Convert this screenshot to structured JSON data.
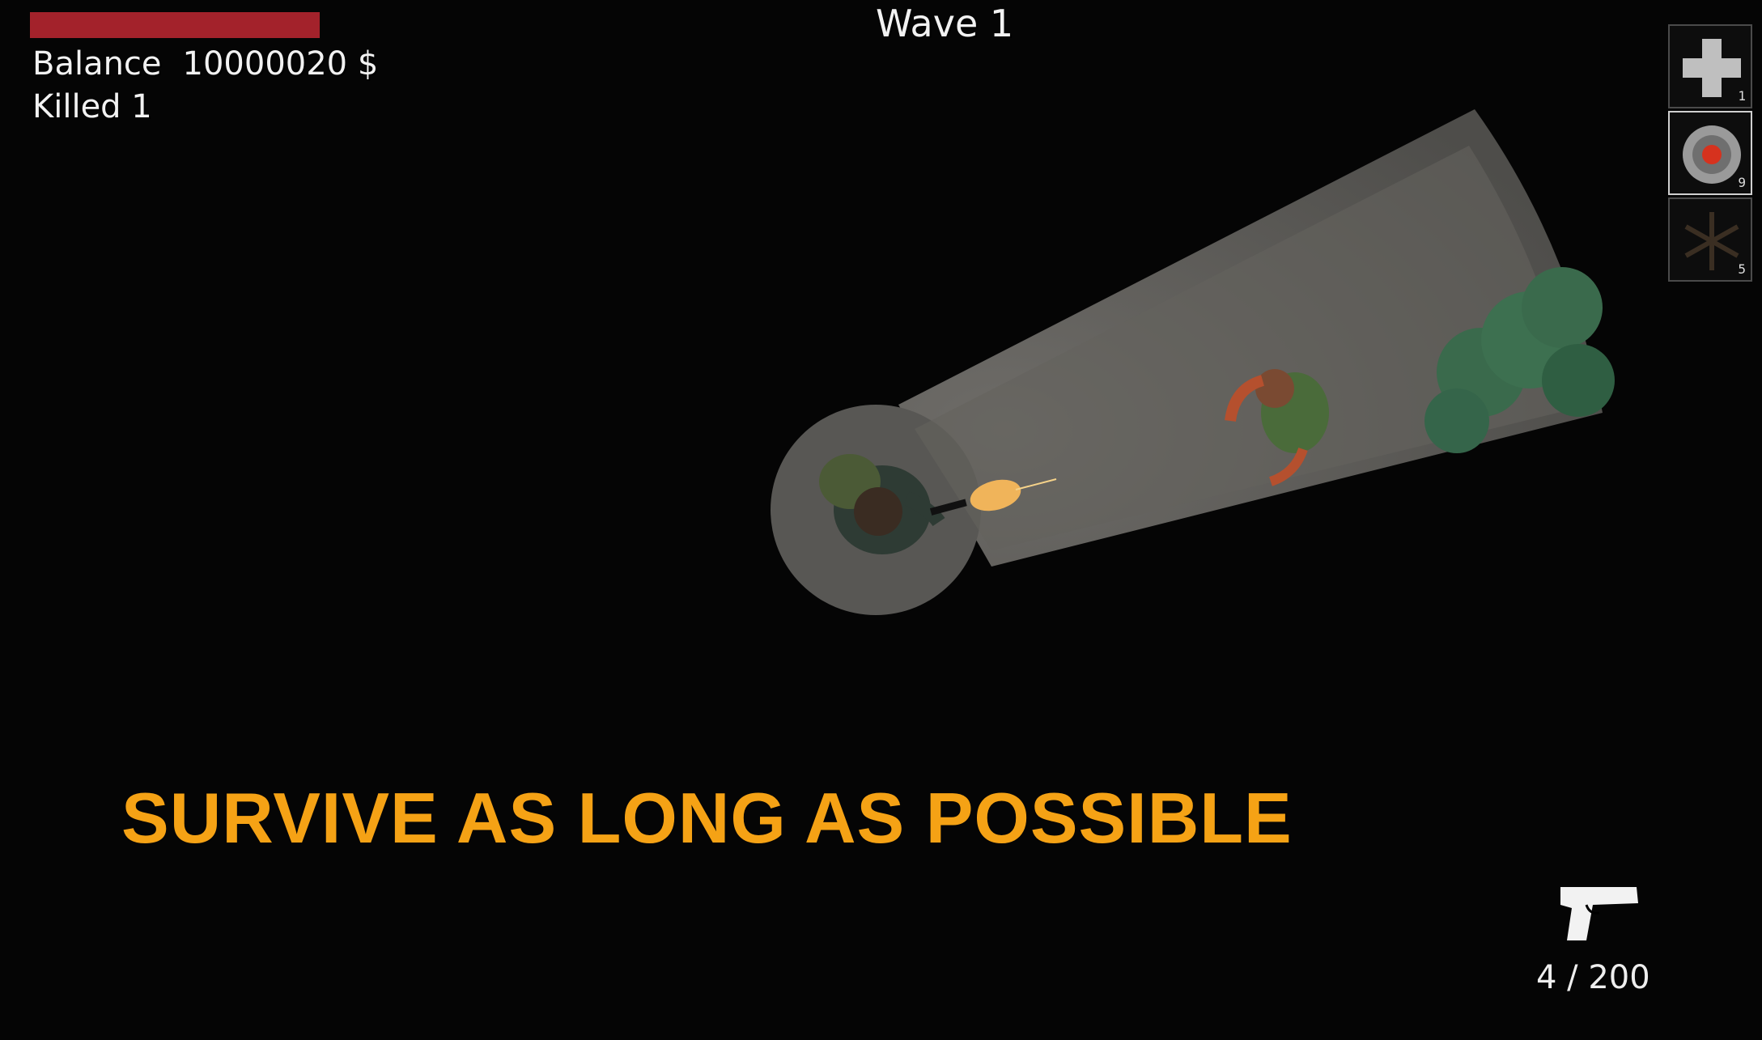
{
  "hud": {
    "health": 1.0,
    "balance_label": "Balance",
    "balance_value": "10000020 $",
    "killed_label": "Killed",
    "killed_value": "1",
    "wave_label": "Wave",
    "wave_value": "1"
  },
  "inventory": [
    {
      "item": "medkit-icon",
      "count": "1",
      "selected": false
    },
    {
      "item": "landmine-icon",
      "count": "9",
      "selected": true
    },
    {
      "item": "caltrops-icon",
      "count": "5",
      "selected": false
    }
  ],
  "banner": "SURVIVE AS LONG AS POSSIBLE",
  "weapon": {
    "icon": "pistol-icon",
    "ammo": "4 / 200"
  },
  "colors": {
    "health": "#a3222b",
    "banner": "#f5a215",
    "background": "#000000"
  }
}
